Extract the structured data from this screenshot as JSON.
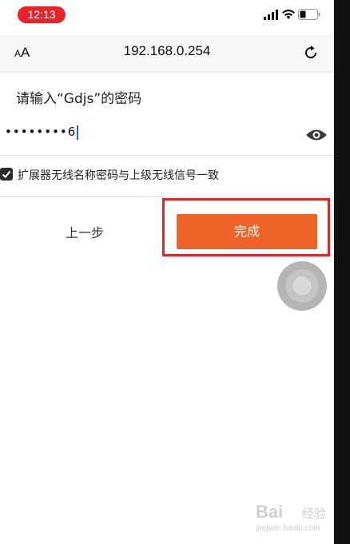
{
  "status_bar": {
    "time": "12:13"
  },
  "address_bar": {
    "text_size_label": "AA",
    "url": "192.168.0.254",
    "reload_icon": "reload-icon"
  },
  "form": {
    "prompt": "请输入“Gdjs”的密码",
    "password_masked": "••••••••",
    "password_last_char": "6",
    "show_password_icon": "eye-icon",
    "sync_checkbox_checked": true,
    "sync_checkbox_label": "扩展器无线名称密码与上级无线信号一致"
  },
  "actions": {
    "prev_label": "上一步",
    "done_label": "完成"
  },
  "colors": {
    "time_pill": "#e8242b",
    "done_button": "#ee6328",
    "highlight_box": "#e3262a"
  },
  "watermark": {
    "brand": "Bai",
    "sub": "经验",
    "url": "jingyan.baidu.com"
  }
}
